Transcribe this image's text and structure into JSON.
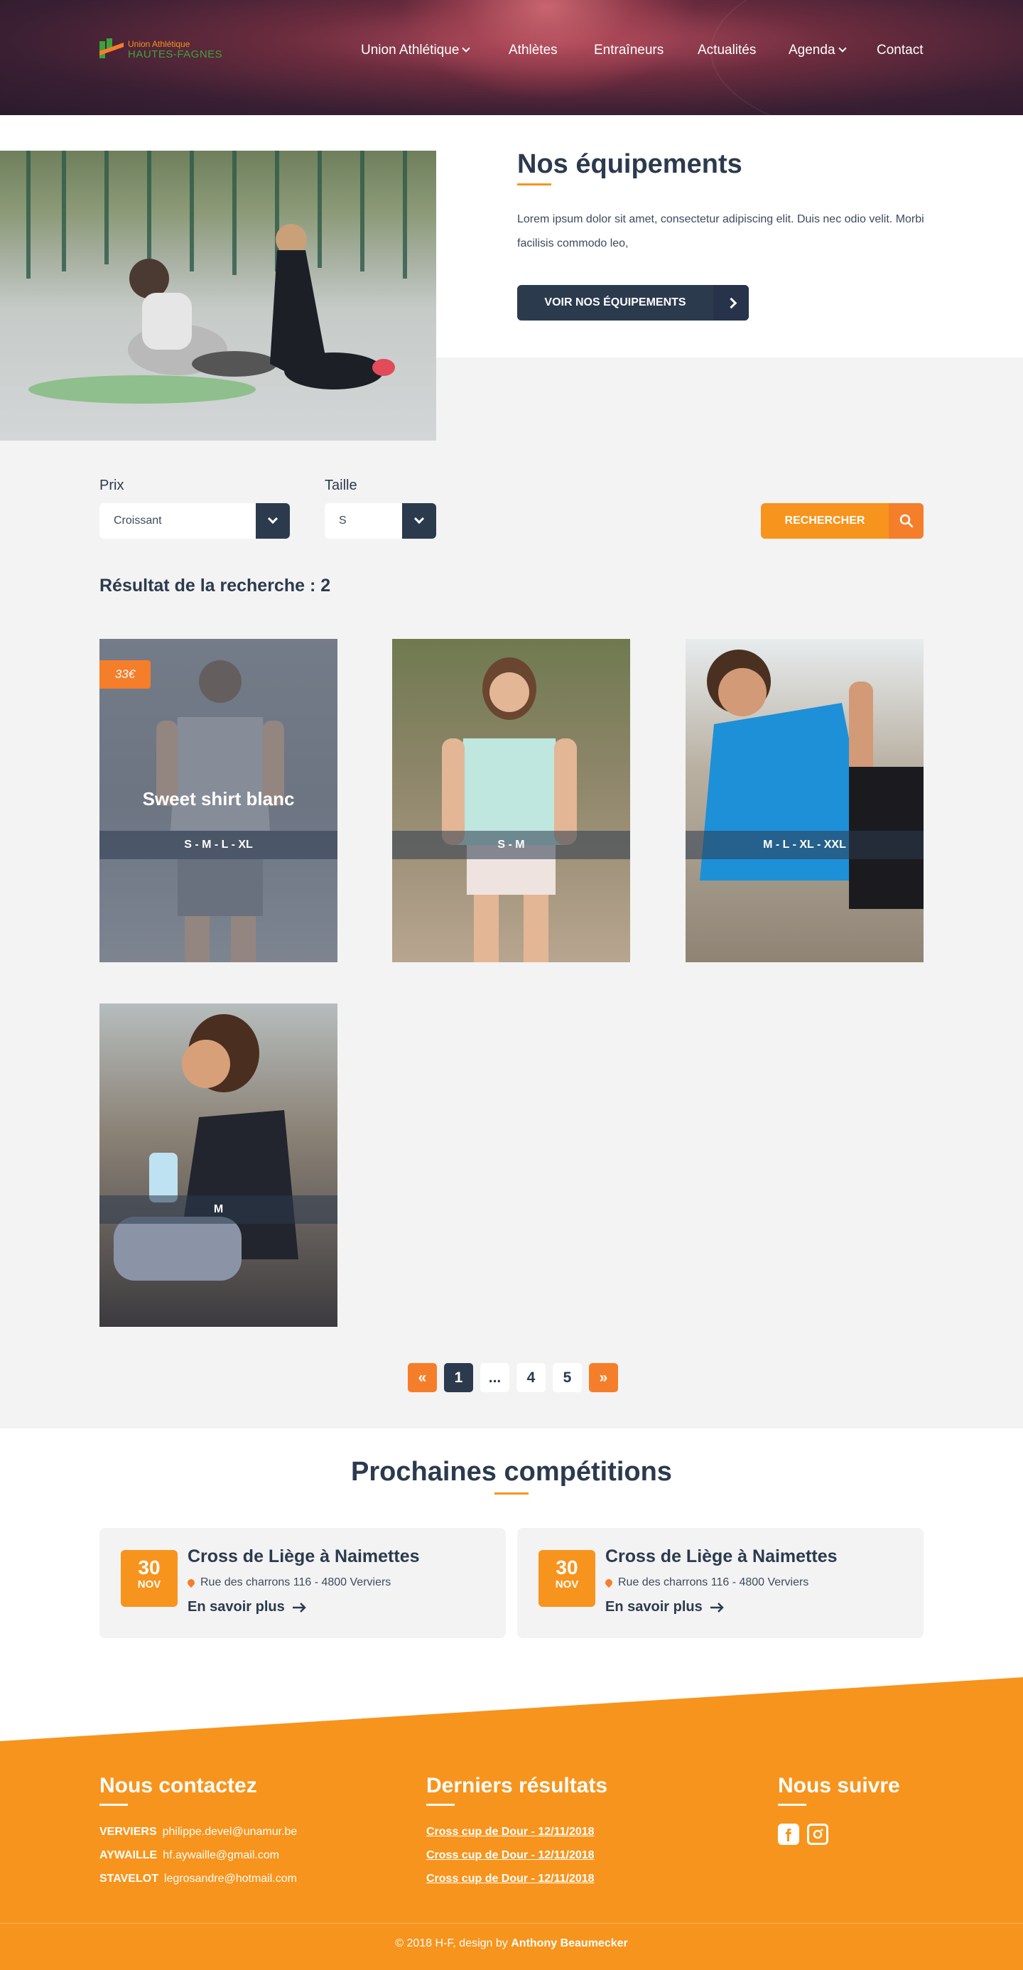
{
  "header": {
    "logo_line1": "Union Athlétique",
    "logo_line2": "HAUTES-FAGNES",
    "nav": [
      {
        "label": "Union Athlétique",
        "has_dropdown": true
      },
      {
        "label": "Athlètes",
        "has_dropdown": false
      },
      {
        "label": "Entraîneurs",
        "has_dropdown": false
      },
      {
        "label": "Actualités",
        "has_dropdown": false
      },
      {
        "label": "Agenda",
        "has_dropdown": true
      },
      {
        "label": "Contact",
        "has_dropdown": false
      }
    ]
  },
  "equipment": {
    "title": "Nos équipements",
    "text": "Lorem ipsum dolor sit amet, consectetur adipiscing  elit. Duis nec odio velit. Morbi facilisis commodo leo,",
    "button_label": "VOIR NOS ÉQUIPEMENTS"
  },
  "filters": {
    "price_label": "Prix",
    "price_value": "Croissant",
    "size_label": "Taille",
    "size_value": "S",
    "search_label": "RECHERCHER"
  },
  "results": {
    "title": "Résultat de la recherche : 2",
    "products": [
      {
        "price": "33€",
        "name": "Sweet shirt blanc",
        "sizes": "S - M - L - XL"
      },
      {
        "price": "",
        "name": "",
        "sizes": "S - M"
      },
      {
        "price": "",
        "name": "",
        "sizes": "M - L - XL - XXL"
      },
      {
        "price": "",
        "name": "",
        "sizes": "M"
      }
    ]
  },
  "pagination": {
    "first": "«",
    "pages": [
      "1",
      "...",
      "4",
      "5"
    ],
    "current": "1",
    "last": "»"
  },
  "competitions": {
    "title": "Prochaines compétitions",
    "events": [
      {
        "day": "30",
        "month": "NOV",
        "title": "Cross de Liège à Naimettes",
        "address": "Rue des charrons 116 - 4800 Verviers",
        "more": "En savoir plus"
      },
      {
        "day": "30",
        "month": "NOV",
        "title": "Cross de Liège à Naimettes",
        "address": "Rue des charrons 116 - 4800 Verviers",
        "more": "En savoir plus"
      }
    ]
  },
  "footer": {
    "contact_title": "Nous contactez",
    "contacts": [
      {
        "city": "VERVIERS",
        "email": "philippe.devel@unamur.be"
      },
      {
        "city": "AYWAILLE",
        "email": "hf.aywaille@gmail.com"
      },
      {
        "city": "STAVELOT",
        "email": "legrosandre@hotmail.com"
      }
    ],
    "results_title": "Derniers résultats",
    "results": [
      "Cross cup de Dour - 12/11/2018",
      "Cross cup de Dour - 12/11/2018",
      "Cross cup de Dour - 12/11/2018"
    ],
    "follow_title": "Nous suivre",
    "social": [
      "facebook-icon",
      "instagram-icon"
    ],
    "copyright": "© 2018 H-F, design by",
    "designer": "Anthony Beaumecker"
  },
  "colors": {
    "navy": "#2c3a4e",
    "orange": "#f7941d",
    "orange_dark": "#f57e2b",
    "grey_bg": "#f3f3f3"
  }
}
